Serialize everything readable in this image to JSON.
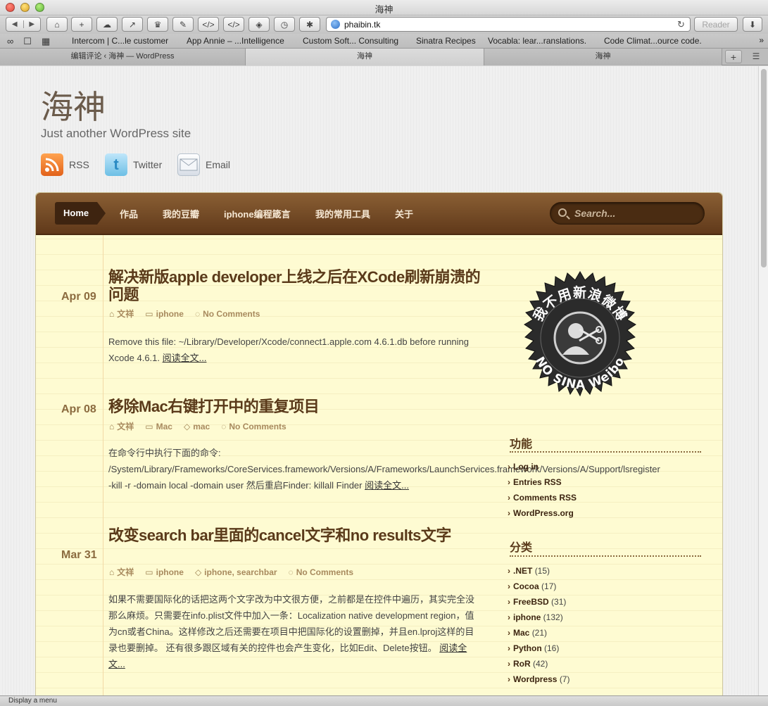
{
  "window": {
    "title": "海神"
  },
  "toolbar": {
    "url": "phaibin.tk",
    "reader_label": "Reader",
    "icons": [
      "home-icon",
      "add-icon",
      "cloud-icon",
      "share-icon",
      "crown-icon",
      "pin-icon",
      "code-icon",
      "code-edit-icon",
      "layers-icon",
      "clock-icon",
      "bug-icon"
    ]
  },
  "bookmarks": {
    "items": [
      "Intercom | C...le customer",
      "App Annie – ...Intelligence",
      "Custom Soft... Consulting",
      "Sinatra Recipes",
      "Vocabla: lear...ranslations.",
      "Code Climat...ource code."
    ],
    "more": "»"
  },
  "tabs": {
    "items": [
      "编辑评论 ‹ 海神 — WordPress",
      "海神",
      "海神"
    ],
    "new_tab": "+"
  },
  "site": {
    "title": "海神",
    "description": "Just another WordPress site",
    "social": {
      "rss": "RSS",
      "twitter": "Twitter",
      "email": "Email"
    }
  },
  "nav": {
    "home": "Home",
    "items": [
      "作品",
      "我的豆瓣",
      "iphone编程箴言",
      "我的常用工具",
      "关于"
    ],
    "search_placeholder": "Search..."
  },
  "posts": [
    {
      "date": "Apr 09",
      "title": "解决新版apple developer上线之后在XCode刷新崩溃的问题",
      "author": "文祥",
      "category": "iphone",
      "comments": "No Comments",
      "body": "Remove this file: ~/Library/Developer/Xcode/connect1.apple.com 4.6.1.db before running Xcode 4.6.1.",
      "more": "阅读全文..."
    },
    {
      "date": "Apr 08",
      "title": "移除Mac右键打开中的重复项目",
      "author": "文祥",
      "category": "Mac",
      "tags": "mac",
      "comments": "No Comments",
      "body_lines": [
        "在命令行中执行下面的命令:",
        "/System/Library/Frameworks/CoreServices.framework/Versions/A/Frameworks/LaunchServices.framework/Versions/A/Support/lsregister",
        "-kill -r -domain local -domain user 然后重启Finder:   killall Finder"
      ],
      "more": "阅读全文..."
    },
    {
      "date": "Mar 31",
      "title": "改变search bar里面的cancel文字和no results文字",
      "author": "文祥",
      "category": "iphone",
      "tags": "iphone, searchbar",
      "comments": "No Comments",
      "body": "如果不需要国际化的话把这两个文字改为中文很方便，之前都是在控件中遍历，其实完全没那么麻烦。只需要在info.plist文件中加入一条：Localization native development region，值为cn或者China。这样修改之后还需要在项目中把国际化的设置删掉，并且en.lproj这样的目录也要删掉。 还有很多跟区域有关的控件也会产生变化，比如Edit、Delete按钮。",
      "more": "阅读全文..."
    }
  ],
  "badge": {
    "top_text": "我不用新浪微博",
    "bottom_text": "NO SINA Weibo"
  },
  "sidebar": {
    "meta_title": "功能",
    "meta_items": [
      "Log in",
      "Entries RSS",
      "Comments RSS",
      "WordPress.org"
    ],
    "cat_title": "分类",
    "categories": [
      {
        "name": ".NET",
        "count": "(15)"
      },
      {
        "name": "Cocoa",
        "count": "(17)"
      },
      {
        "name": "FreeBSD",
        "count": "(31)"
      },
      {
        "name": "iphone",
        "count": "(132)"
      },
      {
        "name": "Mac",
        "count": "(21)"
      },
      {
        "name": "Python",
        "count": "(16)"
      },
      {
        "name": "RoR",
        "count": "(42)"
      },
      {
        "name": "Wordpress",
        "count": "(7)"
      }
    ]
  },
  "status": {
    "text": "Display a menu"
  }
}
